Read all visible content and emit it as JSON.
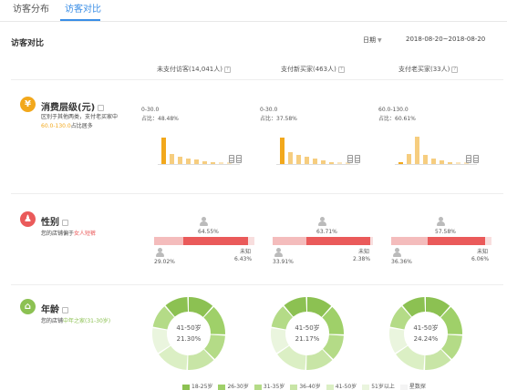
{
  "tabs": [
    {
      "label": "访客分布"
    },
    {
      "label": "访客对比"
    }
  ],
  "header": {
    "title": "访客对比",
    "date_type": "日期",
    "date_range": "2018-08-20~2018-08-20"
  },
  "columns": [
    {
      "label": "未支付访客(14,041人)"
    },
    {
      "label": "支付新买家(463人)"
    },
    {
      "label": "支付老买家(33人)"
    }
  ],
  "rows": {
    "spend": {
      "title": "消费层级(元)",
      "desc_pre": "区别于其他两类，支付老买家中",
      "desc_hl": "60.0-130.0",
      "desc_post": "占比居多",
      "columns": [
        {
          "range": "0-30.0",
          "share": "占比：48.48%",
          "bars": [
            0.9,
            0.35,
            0.25,
            0.2,
            0.15,
            0.1,
            0.05,
            0.03,
            0.02
          ]
        },
        {
          "range": "0-30.0",
          "share": "占比：37.58%",
          "bars": [
            0.9,
            0.4,
            0.3,
            0.25,
            0.2,
            0.12,
            0.06,
            0.03,
            0.02
          ]
        },
        {
          "range": "60.0-130.0",
          "share": "占比：60.61%",
          "bars": [
            0.05,
            0.35,
            0.95,
            0.3,
            0.2,
            0.12,
            0.06,
            0.03,
            0.02
          ]
        }
      ]
    },
    "gender": {
      "title": "性别",
      "desc_pre": "您的店铺偏于",
      "desc_hl": "女人短裤",
      "columns": [
        {
          "female": "64.55%",
          "male": "29.02%",
          "unknown_label": "未知",
          "unknown": "6.43%",
          "female_v": 64.55,
          "male_v": 29.02,
          "unknown_v": 6.43
        },
        {
          "female": "63.71%",
          "male": "33.91%",
          "unknown_label": "未知",
          "unknown": "2.38%",
          "female_v": 63.71,
          "male_v": 33.91,
          "unknown_v": 2.38
        },
        {
          "female": "57.58%",
          "male": "36.36%",
          "unknown_label": "未知",
          "unknown": "6.06%",
          "female_v": 57.58,
          "male_v": 36.36,
          "unknown_v": 6.06
        }
      ]
    },
    "age": {
      "title": "年龄",
      "desc_pre": "您的店铺",
      "desc_hl": "中年之家(31-30岁)",
      "columns": [
        {
          "range": "41-50岁",
          "share": "21.30%"
        },
        {
          "range": "41-50岁",
          "share": "21.17%"
        },
        {
          "range": "41-50岁",
          "share": "24.24%"
        }
      ]
    }
  },
  "legend": [
    {
      "label": "18-25岁",
      "color": "#8cc152"
    },
    {
      "label": "26-30岁",
      "color": "#9fd069"
    },
    {
      "label": "31-35岁",
      "color": "#b4db87"
    },
    {
      "label": "36-40岁",
      "color": "#c8e5a6"
    },
    {
      "label": "41-50岁",
      "color": "#dbefc4"
    },
    {
      "label": "51岁以上",
      "color": "#eaf5de"
    },
    {
      "label": "星数探",
      "color": "#f4f4f4"
    }
  ],
  "colors": {
    "accent": "#3a8ee6",
    "orange": "#f2a81c",
    "red": "#ea5a5a",
    "green": "#8cc152"
  }
}
